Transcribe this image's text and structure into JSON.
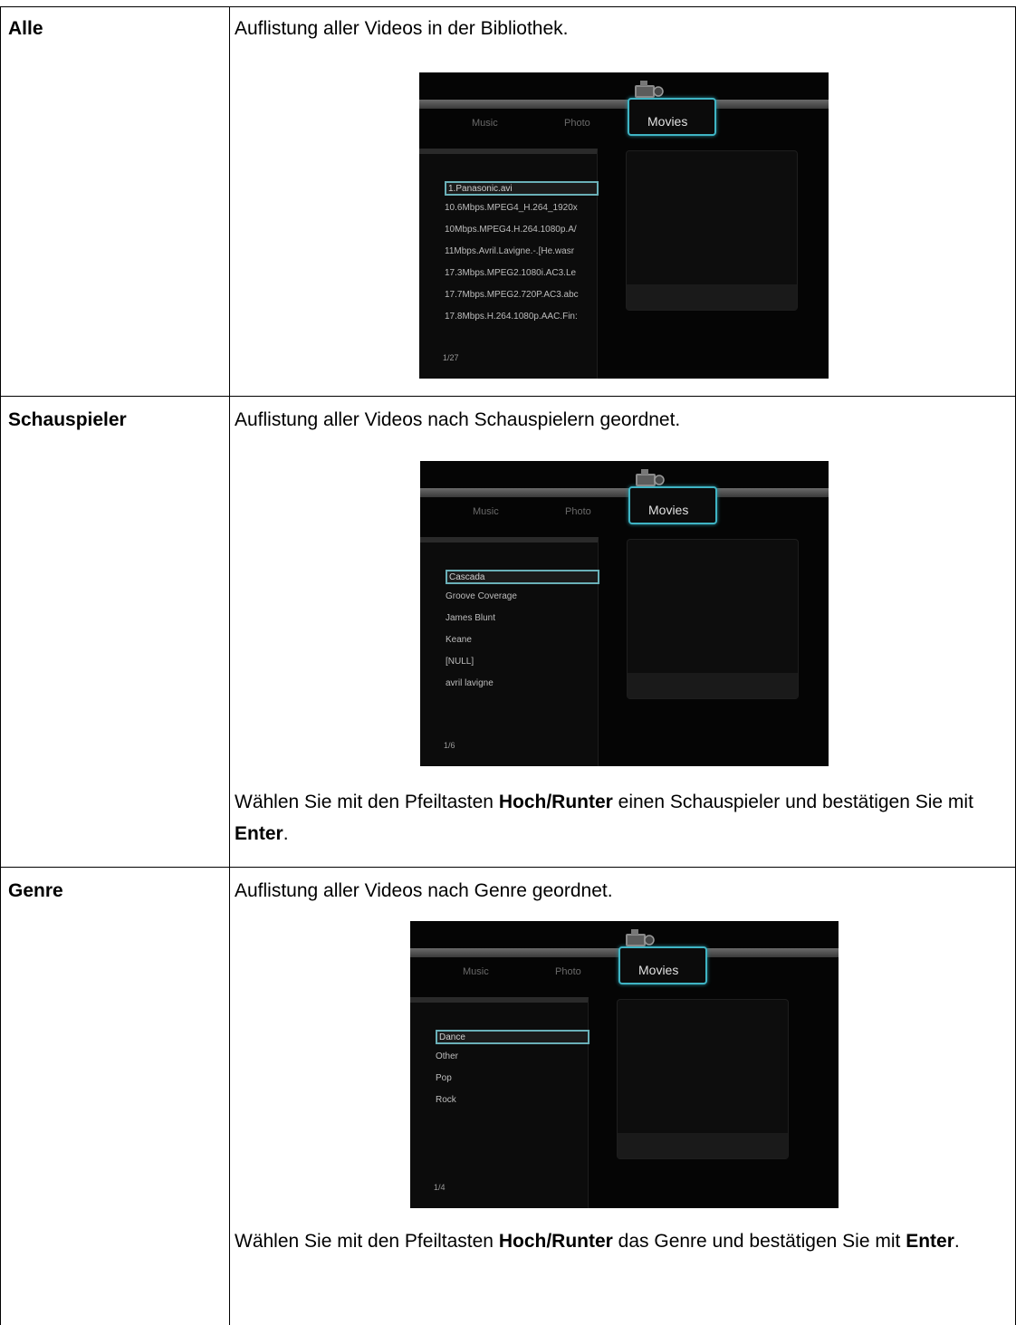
{
  "rows": [
    {
      "label": "Alle",
      "description": "Auflistung aller Videos in der Bibliothek.",
      "screen": {
        "tabs": [
          "Music",
          "Photo",
          "Movies"
        ],
        "items": [
          "1.Panasonic.avi",
          "10.6Mbps.MPEG4_H.264_1920x",
          "10Mbps.MPEG4.H.264.1080p.A/",
          "11Mbps.Avril.Lavigne.-.[He.wasr",
          "17.3Mbps.MPEG2.1080i.AC3.Le",
          "17.7Mbps.MPEG2.720P.AC3.abc",
          "17.8Mbps.H.264.1080p.AAC.Fin:"
        ],
        "selected_index": 0,
        "pager": "1/27"
      }
    },
    {
      "label": "Schauspieler",
      "description": "Auflistung aller Videos nach Schauspielern geordnet.",
      "screen": {
        "tabs": [
          "Music",
          "Photo",
          "Movies"
        ],
        "items": [
          "Cascada",
          "Groove Coverage",
          "James Blunt",
          "Keane",
          "[NULL]",
          "avril lavigne"
        ],
        "selected_index": 0,
        "pager": "1/6"
      },
      "instruction": {
        "pre": "Wählen Sie mit den Pfeiltasten ",
        "key1": "Hoch/Runter",
        "mid": " einen Schauspieler und bestätigen Sie mit ",
        "key2": "Enter",
        "post": "."
      }
    },
    {
      "label": "Genre",
      "description": "Auflistung aller Videos nach Genre geordnet.",
      "screen": {
        "tabs": [
          "Music",
          "Photo",
          "Movies"
        ],
        "items": [
          "Dance",
          "Other",
          "Pop",
          "Rock"
        ],
        "selected_index": 0,
        "pager": "1/4"
      },
      "instruction": {
        "pre": "Wählen Sie mit den Pfeiltasten ",
        "key1": "Hoch/Runter",
        "mid": " das Genre und bestätigen Sie mit ",
        "key2": "Enter",
        "post": "."
      }
    }
  ],
  "colors": {
    "accent": "#3fb4c4",
    "screen_bg": "#050505"
  }
}
